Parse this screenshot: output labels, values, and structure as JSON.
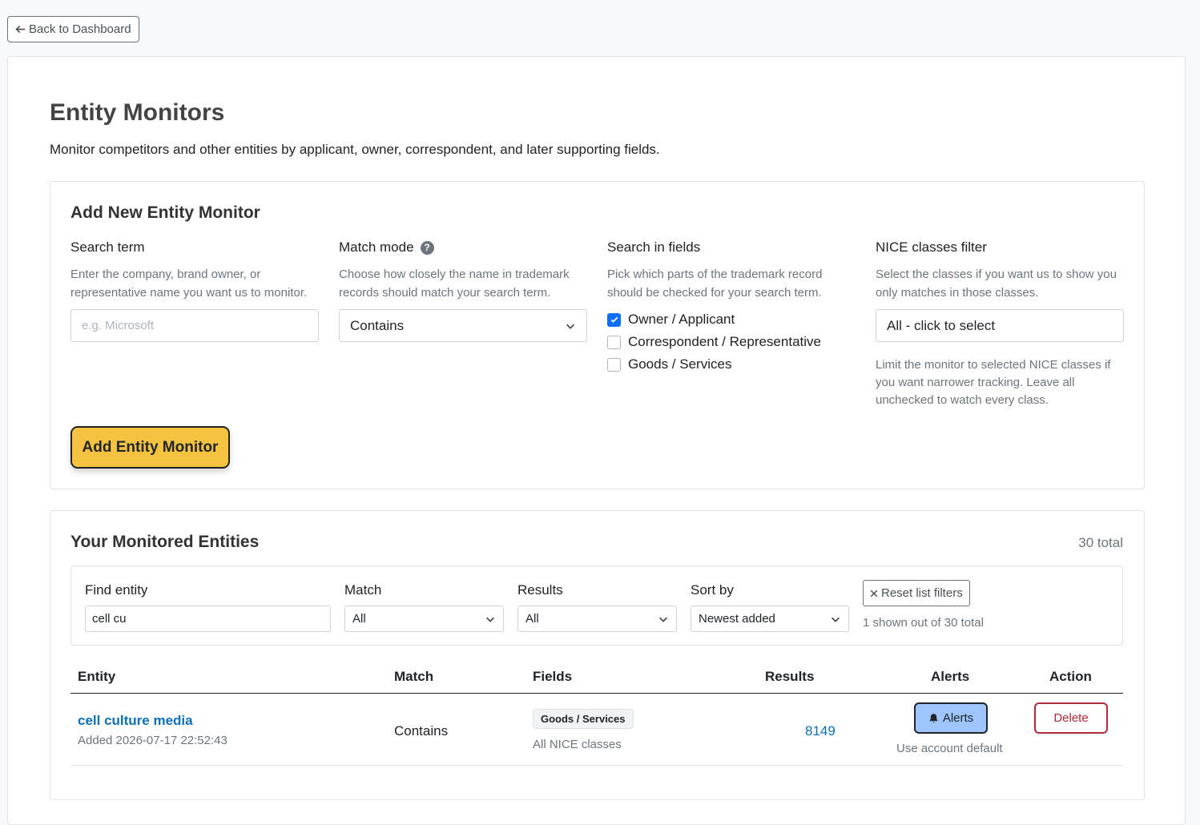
{
  "nav": {
    "back_label": "Back to Dashboard"
  },
  "page": {
    "title": "Entity Monitors",
    "description": "Monitor competitors and other entities by applicant, owner, correspondent, and later supporting fields."
  },
  "add_form": {
    "title": "Add New Entity Monitor",
    "search_term": {
      "label": "Search term",
      "help": "Enter the company, brand owner, or representative name you want us to monitor.",
      "placeholder": "e.g. Microsoft",
      "value": ""
    },
    "match_mode": {
      "label": "Match mode",
      "help_icon": "question-circle-icon",
      "help": "Choose how closely the name in trademark records should match your search term.",
      "selected": "Contains"
    },
    "search_fields": {
      "label": "Search in fields",
      "help": "Pick which parts of the trademark record should be checked for your search term.",
      "options": [
        {
          "label": "Owner / Applicant",
          "checked": true
        },
        {
          "label": "Correspondent / Representative",
          "checked": false
        },
        {
          "label": "Goods / Services",
          "checked": false
        }
      ]
    },
    "nice_filter": {
      "label": "NICE classes filter",
      "help": "Select the classes if you want us to show you only matches in those classes.",
      "selected": "All - click to select",
      "note": "Limit the monitor to selected NICE classes if you want narrower tracking. Leave all unchecked to watch every class."
    },
    "submit_label": "Add Entity Monitor"
  },
  "list": {
    "title": "Your Monitored Entities",
    "total": "30 total",
    "filters": {
      "find_label": "Find entity",
      "find_value": "cell cu",
      "match_label": "Match",
      "match_value": "All",
      "results_label": "Results",
      "results_value": "All",
      "sort_label": "Sort by",
      "sort_value": "Newest added",
      "reset_label": "Reset list filters",
      "shown_text": "1 shown out of 30 total"
    },
    "columns": [
      "Entity",
      "Match",
      "Fields",
      "Results",
      "Alerts",
      "Action"
    ],
    "rows": [
      {
        "entity": "cell culture media",
        "added": "Added 2026-07-17 22:52:43",
        "match": "Contains",
        "fields_badge": "Goods / Services",
        "nice": "All NICE classes",
        "results": "8149",
        "alerts_label": "Alerts",
        "alerts_note": "Use account default",
        "action_label": "Delete"
      }
    ]
  },
  "colors": {
    "primary_button": "#f6c341",
    "link": "#0b6fb8",
    "alerts_button": "#9ec5fe",
    "danger": "#b02a37",
    "checkbox_on": "#0d6efd"
  }
}
